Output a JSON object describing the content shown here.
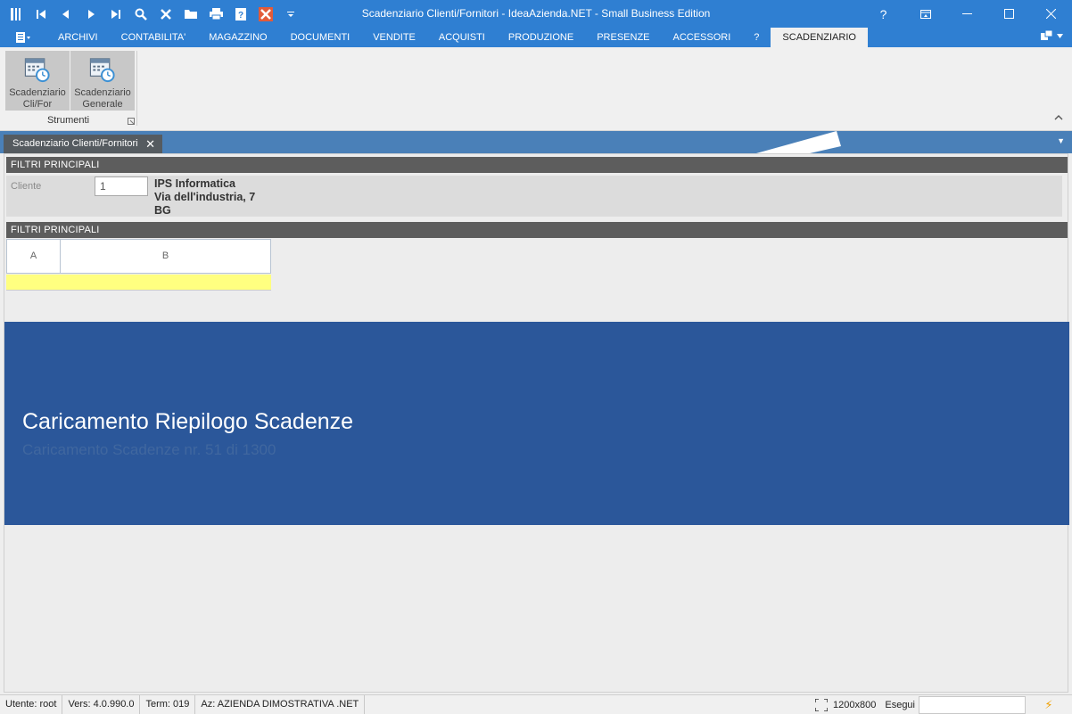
{
  "window": {
    "title": "Scadenziario Clienti/Fornitori - IdeaAzienda.NET - Small Business Edition",
    "help_label": "?"
  },
  "ribbon_tabs": [
    {
      "label": "ARCHIVI"
    },
    {
      "label": "CONTABILITA'"
    },
    {
      "label": "MAGAZZINO"
    },
    {
      "label": "DOCUMENTI"
    },
    {
      "label": "VENDITE"
    },
    {
      "label": "ACQUISTI"
    },
    {
      "label": "PRODUZIONE"
    },
    {
      "label": "PRESENZE"
    },
    {
      "label": "ACCESSORI"
    },
    {
      "label": "?"
    },
    {
      "label": "SCADENZIARIO",
      "active": true
    }
  ],
  "ribbon": {
    "group_label": "Strumenti",
    "buttons": [
      {
        "line1": "Scadenziario",
        "line2": "Cli/For"
      },
      {
        "line1": "Scadenziario",
        "line2": "Generale"
      }
    ]
  },
  "doc_tab": {
    "label": "Scadenziario Clienti/Fornitori"
  },
  "filters": {
    "section1_title": "FILTRI PRINCIPALI",
    "section2_title": "FILTRI PRINCIPALI",
    "cliente_label": "Cliente",
    "cliente_value": "1",
    "cliente_name": "IPS Informatica",
    "cliente_address": "Via dell'industria, 7",
    "cliente_prov": "BG"
  },
  "grid": {
    "columns": [
      "A",
      "B"
    ]
  },
  "loading": {
    "title": "Caricamento Riepilogo Scadenze",
    "subtitle": "Caricamento Scadenze nr. 51 di 1300"
  },
  "status": {
    "user": "Utente: root",
    "version": "Vers: 4.0.990.0",
    "term": "Term: 019",
    "company": "Az: AZIENDA DIMOSTRATIVA .NET",
    "resolution": "1200x800",
    "exec_label": "Esegui"
  },
  "colors": {
    "titlebar": "#2f7fd2",
    "loading_panel": "#2b579a",
    "section_header": "#5d5d5d",
    "grid_row": "#ffff80"
  }
}
